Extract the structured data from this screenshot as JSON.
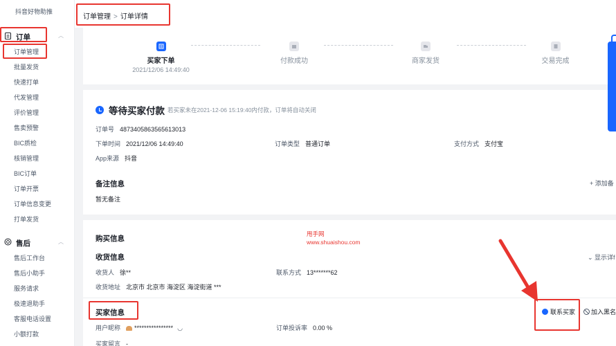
{
  "sidebar": {
    "top_item": "抖音好物助推",
    "order_group": {
      "label": "订单",
      "items": [
        "订单管理",
        "批量发货",
        "快速打单",
        "代发管理",
        "评价管理",
        "售卖预警",
        "BIC质检",
        "核销管理",
        "BIC订单",
        "订单开票",
        "订单信息变更",
        "打单发货"
      ]
    },
    "aftersale_group": {
      "label": "售后",
      "items": [
        "售后工作台",
        "售后小助手",
        "服务请求",
        "极速退助手",
        "客服电话设置",
        "小额打款"
      ]
    }
  },
  "breadcrumb": {
    "parent": "订单管理",
    "separator": ">",
    "current": "订单详情"
  },
  "steps": [
    {
      "label": "买家下单",
      "date": "2021/12/06 14:49:40"
    },
    {
      "label": "付款成功",
      "date": ""
    },
    {
      "label": "商家发货",
      "date": ""
    },
    {
      "label": "交易完成",
      "date": ""
    }
  ],
  "status": {
    "title": "等待买家付款",
    "note": "若买家未在2021-12-06 15:19:40内付款，订单将自动关闭"
  },
  "order": {
    "order_no_label": "订单号",
    "order_no": "4873405863565613013",
    "time_label": "下单时间",
    "time": "2021/12/06 14:49:40",
    "type_label": "订单类型",
    "type": "普通订单",
    "pay_label": "支付方式",
    "pay": "支付宝",
    "source_label": "App来源",
    "source": "抖音"
  },
  "remark": {
    "title": "备注信息",
    "content": "暂无备注",
    "add_label": "+ 添加备"
  },
  "purchase": {
    "title": "购买信息",
    "watermark_line1": "甩手网",
    "watermark_line2": "www.shuaishou.com",
    "shipping_title": "收货信息",
    "show_detail": "⌄ 显示详f",
    "receiver_label": "收货人",
    "receiver": "徐**",
    "contact_label": "联系方式",
    "contact": "13*******62",
    "address_label": "收货地址",
    "address": "北京市 北京市 海淀区 海淀街道 ***"
  },
  "buyer": {
    "title": "买家信息",
    "nick_label": "用户昵称",
    "nick": "****************",
    "complaint_label": "订单投诉率",
    "complaint": "0.00 %",
    "message_label": "买家留言",
    "message": "-",
    "contact_button": "联系买家",
    "block_button": "加入黑名"
  },
  "colors": {
    "accent": "#1966ff",
    "annotation": "#e8352f"
  }
}
